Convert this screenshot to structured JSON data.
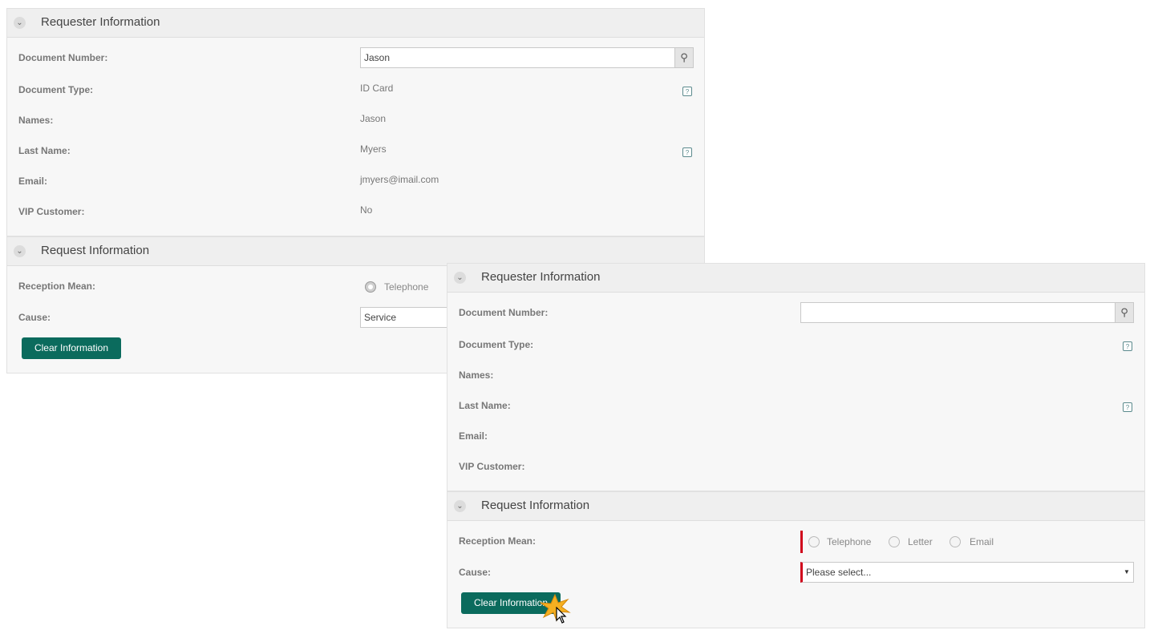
{
  "colors": {
    "accent": "#0b6b5d",
    "required": "#d0021b"
  },
  "before": {
    "requester": {
      "title": "Requester Information",
      "doc_number_label": "Document Number:",
      "doc_number_value": "Jason",
      "doc_type_label": "Document Type:",
      "doc_type_value": "ID Card",
      "names_label": "Names:",
      "names_value": "Jason",
      "last_name_label": "Last Name:",
      "last_name_value": "Myers",
      "email_label": "Email:",
      "email_value": "jmyers@imail.com",
      "vip_label": "VIP Customer:",
      "vip_value": "No"
    },
    "request": {
      "title": "Request Information",
      "reception_label": "Reception Mean:",
      "reception_option": "Telephone",
      "cause_label": "Cause:",
      "cause_value": "Service",
      "clear_button": "Clear Information"
    }
  },
  "after": {
    "requester": {
      "title": "Requester Information",
      "doc_number_label": "Document Number:",
      "doc_number_value": "",
      "doc_type_label": "Document Type:",
      "names_label": "Names:",
      "last_name_label": "Last Name:",
      "email_label": "Email:",
      "vip_label": "VIP Customer:"
    },
    "request": {
      "title": "Request Information",
      "reception_label": "Reception Mean:",
      "options": [
        "Telephone",
        "Letter",
        "Email"
      ],
      "cause_label": "Cause:",
      "cause_placeholder": "Please select...",
      "clear_button": "Clear Information"
    }
  }
}
